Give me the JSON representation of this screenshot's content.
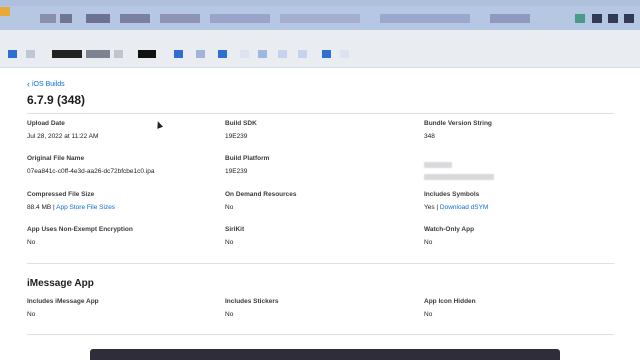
{
  "nav": {
    "back_label": "iOS Builds"
  },
  "build": {
    "title": "6.7.9 (348)"
  },
  "fields": {
    "upload_date": {
      "label": "Upload Date",
      "value": "Jul 28, 2022 at 11:22 AM"
    },
    "build_sdk": {
      "label": "Build SDK",
      "value": "19E239"
    },
    "bundle_version": {
      "label": "Bundle Version String",
      "value": "348"
    },
    "original_file_name": {
      "label": "Original File Name",
      "value": "07ea841c-c0ff-4e3d-aa26-dc72bfcbe1c0.ipa"
    },
    "build_platform": {
      "label": "Build Platform",
      "value": "19E239"
    },
    "compressed_size": {
      "label": "Compressed File Size",
      "value": "88.4 MB",
      "separator": " | ",
      "link": "App Store File Sizes"
    },
    "on_demand": {
      "label": "On Demand Resources",
      "value": "No"
    },
    "includes_symbols": {
      "label": "Includes Symbols",
      "value": "Yes",
      "separator": " | ",
      "link": "Download dSYM"
    },
    "encryption": {
      "label": "App Uses Non-Exempt Encryption",
      "value": "No"
    },
    "sirikit": {
      "label": "SiriKit",
      "value": "No"
    },
    "watch_only": {
      "label": "Watch-Only App",
      "value": "No"
    }
  },
  "imessage": {
    "title": "iMessage App",
    "includes_imessage": {
      "label": "Includes iMessage App",
      "value": "No"
    },
    "includes_stickers": {
      "label": "Includes Stickers",
      "value": "No"
    },
    "icon_hidden": {
      "label": "App Icon Hidden",
      "value": "No"
    }
  },
  "colors": {
    "link": "#0a6ed1",
    "chrome": "#b6c7e3",
    "bookmark_bar": "#e9ecf1"
  },
  "icons": {
    "back": "chevron-left-icon",
    "cursor": "mouse-pointer-icon"
  }
}
